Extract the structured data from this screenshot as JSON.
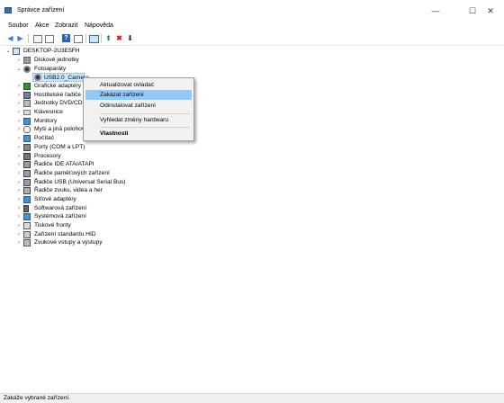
{
  "window": {
    "title": "Správce zařízení",
    "minimize": "—",
    "maximize": "☐",
    "close": "✕"
  },
  "menu": [
    "Soubor",
    "Akce",
    "Zobrazit",
    "Nápověda"
  ],
  "toolbar": {
    "back": "◀",
    "forward": "▶",
    "enable_driver": "⬆",
    "disable_device": "✖",
    "update": "⬇"
  },
  "tree": {
    "root": "DESKTOP-2U3E5FH",
    "items": [
      {
        "label": "Diskové jednotky",
        "icon": "disk-drive-icon"
      },
      {
        "label": "Fotoaparáty",
        "icon": "camera-icon",
        "expanded": true,
        "children": [
          {
            "label": "USB2.0_Camera"
          }
        ]
      },
      {
        "label": "Grafické adaptéry",
        "icon": "display-adapter-icon"
      },
      {
        "label": "Hostitelské řadiče I",
        "icon": "controller-icon"
      },
      {
        "label": "Jednotky DVD/CD-",
        "icon": "dvd-icon"
      },
      {
        "label": "Klávesnice",
        "icon": "keyboard-icon"
      },
      {
        "label": "Monitory",
        "icon": "monitor-icon"
      },
      {
        "label": "Myši a jiná polohov",
        "icon": "mouse-icon"
      },
      {
        "label": "Počítač",
        "icon": "computer-icon"
      },
      {
        "label": "Porty (COM a LPT)",
        "icon": "port-icon"
      },
      {
        "label": "Procesory",
        "icon": "processor-icon"
      },
      {
        "label": "Řadiče IDE ATA/ATAPI",
        "icon": "ide-controller-icon"
      },
      {
        "label": "Řadiče paměťových zařízení",
        "icon": "storage-controller-icon"
      },
      {
        "label": "Řadiče USB (Universal Serial Bus)",
        "icon": "usb-controller-icon"
      },
      {
        "label": "Řadiče zvuku, videa a her",
        "icon": "sound-icon"
      },
      {
        "label": "Síťové adaptéry",
        "icon": "network-adapter-icon"
      },
      {
        "label": "Softwarová zařízení",
        "icon": "software-device-icon"
      },
      {
        "label": "Systémová zařízení",
        "icon": "system-device-icon"
      },
      {
        "label": "Tiskové fronty",
        "icon": "print-queue-icon"
      },
      {
        "label": "Zařízení standardu HID",
        "icon": "hid-icon"
      },
      {
        "label": "Zvukové vstupy a výstupy",
        "icon": "audio-io-icon"
      }
    ]
  },
  "context_menu": {
    "update_driver": "Aktualizovat ovladač",
    "disable_device": "Zakázat zařízení",
    "uninstall_device": "Odinstalovat zařízení",
    "scan_hardware": "Vyhledat změny hardwaru",
    "properties": "Vlastnosti"
  },
  "status": "Zakáže vybrané zařízení.",
  "colors": {
    "highlight": "#91c9f7",
    "menu_bg": "#f2f2f2",
    "status_bg": "#f0f0f0"
  }
}
